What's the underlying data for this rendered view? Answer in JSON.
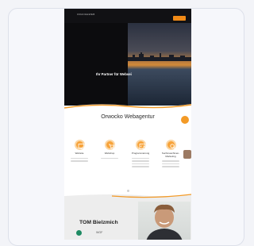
{
  "hero": {
    "logo": "ORANGEWEB",
    "title": "Ihr Partner für Websei",
    "cta_label": ""
  },
  "services": {
    "title": "Orwocko Webagentur",
    "items": [
      {
        "label": "Website",
        "icon": "monitor-icon"
      },
      {
        "label": "Webshop",
        "icon": "cart-icon"
      },
      {
        "label": "Programmierung",
        "icon": "code-icon"
      },
      {
        "label": "Suchmaschinen-Marketing",
        "icon": "search-icon"
      }
    ]
  },
  "team": {
    "title": "TOM Bielzmich",
    "subtitle": "WGF"
  },
  "colors": {
    "accent": "#f39a26",
    "dark": "#0c0c0e",
    "green": "#1e8a63"
  }
}
